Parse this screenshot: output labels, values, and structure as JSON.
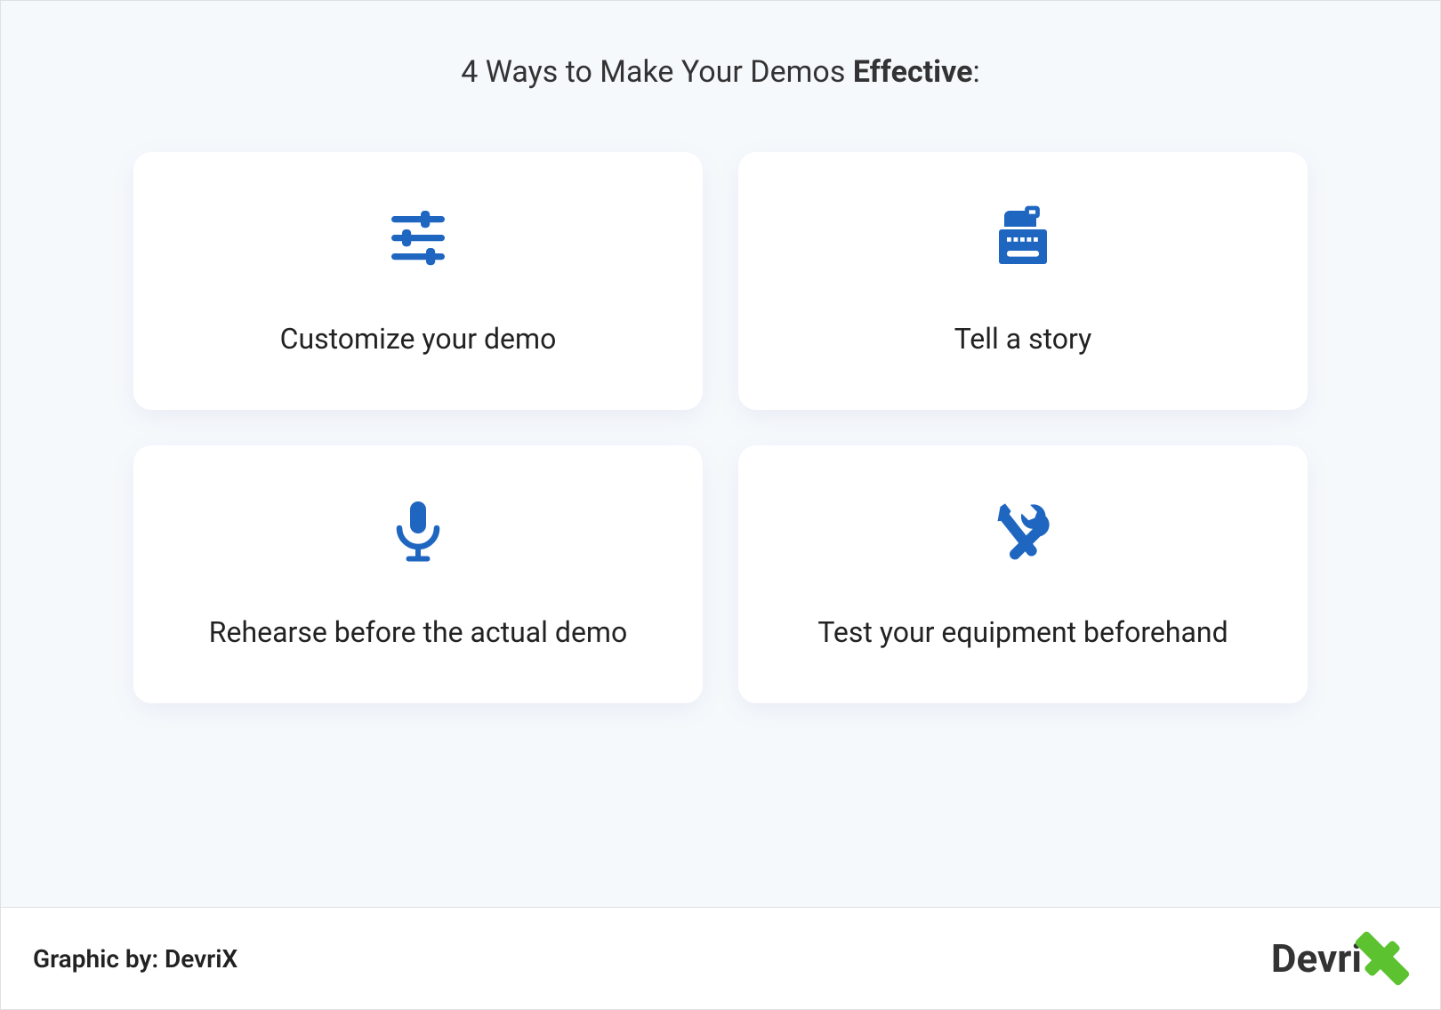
{
  "title_prefix": "4 Ways to Make Your Demos ",
  "title_bold": "Effective",
  "title_suffix": ":",
  "cards": [
    {
      "icon": "sliders",
      "label": "Customize your demo"
    },
    {
      "icon": "typewriter",
      "label": "Tell a story"
    },
    {
      "icon": "microphone",
      "label": "Rehearse before the actual demo"
    },
    {
      "icon": "tools",
      "label": "Test your equipment beforehand"
    }
  ],
  "footer_text": "Graphic by: DevriX",
  "logo_text": "Devri",
  "colors": {
    "icon": "#1f66c1",
    "accent": "#5cc22f",
    "bg": "#f6f9fc"
  }
}
